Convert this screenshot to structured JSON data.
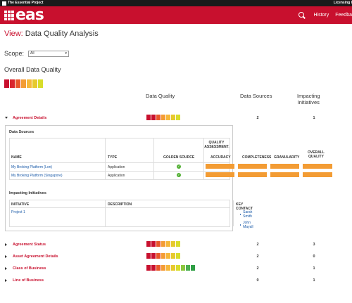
{
  "topbar": {
    "brand": "The Essential Project",
    "licensing": "Licensing I"
  },
  "navbar": {
    "logo_text": "eas",
    "history": "History",
    "feedback": "Feedba"
  },
  "title": {
    "prefix": "View:",
    "text": "Data Quality Analysis"
  },
  "scope": {
    "label": "Scope:",
    "value": "All"
  },
  "overall": {
    "label": "Overall Data Quality",
    "bar_colors": [
      "#c8102e",
      "#d9262e",
      "#e8572a",
      "#f39c34",
      "#f5b83a",
      "#e6c92e",
      "#d8dd2a"
    ]
  },
  "columns": {
    "data_quality": "Data Quality",
    "data_sources": "Data Sources",
    "impacting_line1": "Impacting",
    "impacting_line2": "Initiatives"
  },
  "rows": [
    {
      "name": "Agreement Details",
      "sources": "2",
      "initiatives": "1",
      "bars": [
        "#c8102e",
        "#c8102e",
        "#e8572a",
        "#f39c34",
        "#f5b83a",
        "#e6c92e",
        "#d8dd2a"
      ]
    },
    {
      "name": "Agreement Status",
      "sources": "2",
      "initiatives": "3",
      "bars": [
        "#c8102e",
        "#c8102e",
        "#e8572a",
        "#f39c34",
        "#f5b83a",
        "#e6c92e",
        "#d8dd2a"
      ]
    },
    {
      "name": "Asset Agreement Details",
      "sources": "2",
      "initiatives": "0",
      "bars": [
        "#c8102e",
        "#c8102e",
        "#e8572a",
        "#f39c34",
        "#f5b83a",
        "#e6c92e",
        "#d8dd2a"
      ]
    },
    {
      "name": "Class of Business",
      "sources": "2",
      "initiatives": "1",
      "bars": [
        "#c8102e",
        "#c8102e",
        "#e8572a",
        "#f39c34",
        "#f5b83a",
        "#e6c92e",
        "#d8dd2a",
        "#8cc63f",
        "#4caf50",
        "#2e9e44"
      ]
    },
    {
      "name": "Line of Business",
      "sources": "0",
      "initiatives": "1",
      "bars": []
    }
  ],
  "detail": {
    "sources_title": "Data Sources",
    "qa_header": "QUALITY ASSESSMENT",
    "headers": {
      "name": "NAME",
      "type": "TYPE",
      "golden": "GOLDEN SOURCE",
      "accuracy": "ACCURACY",
      "completeness": "COMPLETENESS",
      "granularity": "GRANULARITY",
      "overall1": "OVERALL",
      "overall2": "QUALITY"
    },
    "sources": [
      {
        "name": "My Broking Platform (Lon)",
        "type": "Application"
      },
      {
        "name": "My Broking Platform (Singapore)",
        "type": "Application"
      }
    ],
    "initiatives_title": "Impacting Initiatives",
    "init_headers": {
      "initiative": "INITIATIVE",
      "description": "DESCRIPTION",
      "contact": "KEY CONTACT"
    },
    "initiatives": [
      {
        "name": "Project 1",
        "contacts": [
          "Sarah Smith",
          "John Mayall"
        ]
      }
    ]
  }
}
